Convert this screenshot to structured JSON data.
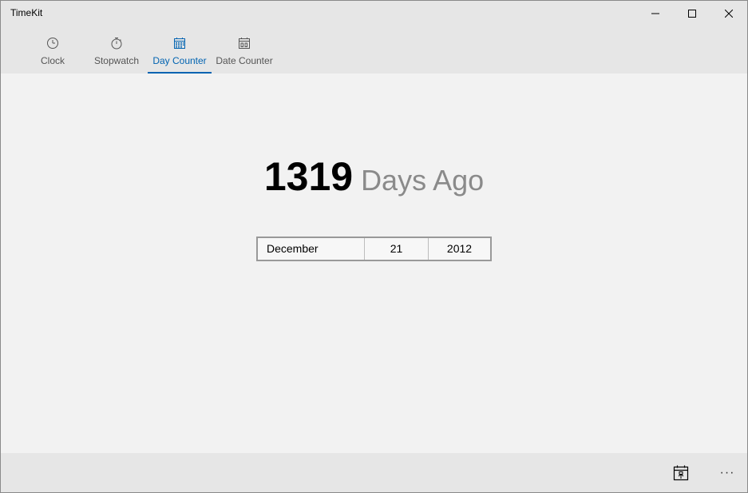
{
  "window": {
    "title": "TimeKit"
  },
  "tabs": [
    {
      "label": "Clock",
      "icon": "clock-icon",
      "active": false
    },
    {
      "label": "Stopwatch",
      "icon": "stopwatch-icon",
      "active": false
    },
    {
      "label": "Day Counter",
      "icon": "calendar-icon",
      "active": true
    },
    {
      "label": "Date Counter",
      "icon": "calendar-grid-icon",
      "active": false
    }
  ],
  "counter": {
    "value": "1319",
    "suffix": "Days Ago"
  },
  "date_picker": {
    "month": "December",
    "day": "21",
    "year": "2012"
  },
  "command_bar": {
    "more_label": "···",
    "pin_icon": "pin-calendar-icon"
  },
  "colors": {
    "accent": "#0063b1",
    "chrome": "#e6e6e6",
    "background": "#f2f2f2"
  }
}
